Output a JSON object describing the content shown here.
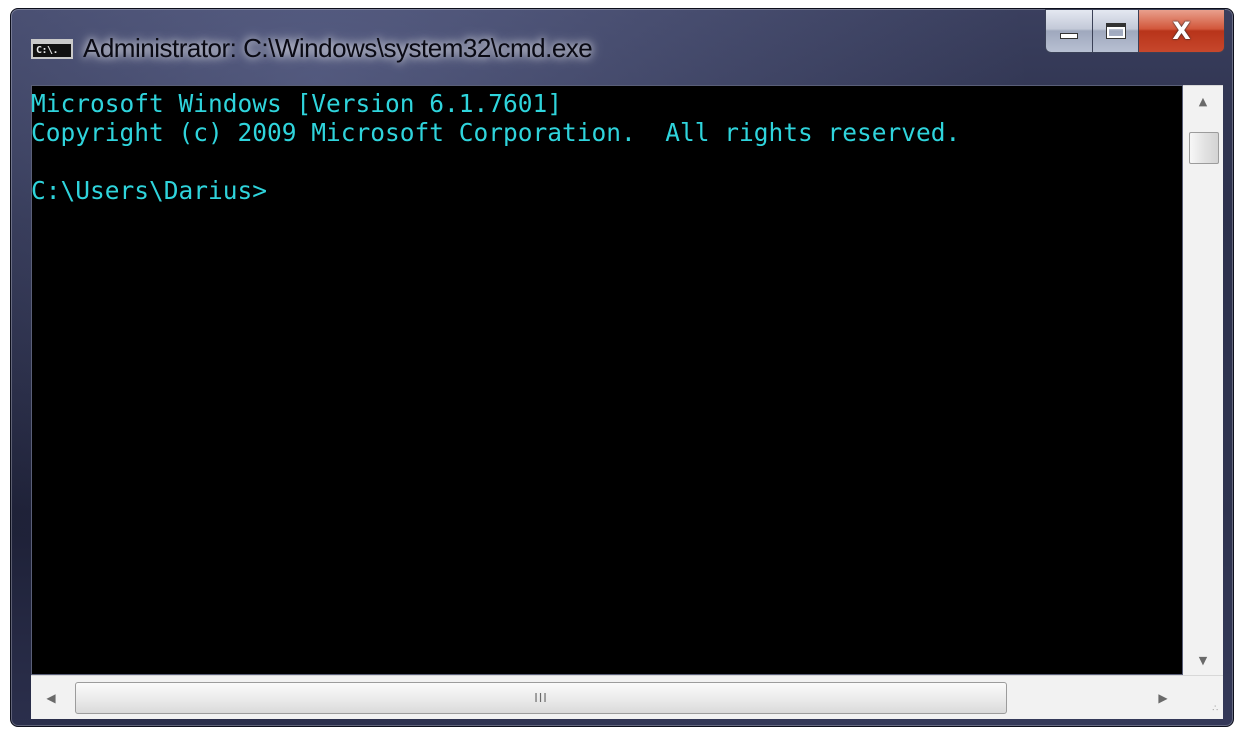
{
  "window": {
    "title": "Administrator: C:\\Windows\\system32\\cmd.exe",
    "icon_label": "C:\\."
  },
  "caption_buttons": {
    "minimize": "minimize-icon",
    "maximize": "maximize-icon",
    "close": "X"
  },
  "console": {
    "lines": [
      "Microsoft Windows [Version 6.1.7601]",
      "Copyright (c) 2009 Microsoft Corporation.  All rights reserved.",
      "",
      "C:\\Users\\Darius>"
    ],
    "text_color": "#2fd4dc",
    "background": "#000000"
  },
  "scrollbars": {
    "up_arrow": "▲",
    "down_arrow": "▼",
    "left_arrow": "◀",
    "right_arrow": "▶",
    "grip": "III",
    "size_grip": "∴"
  }
}
